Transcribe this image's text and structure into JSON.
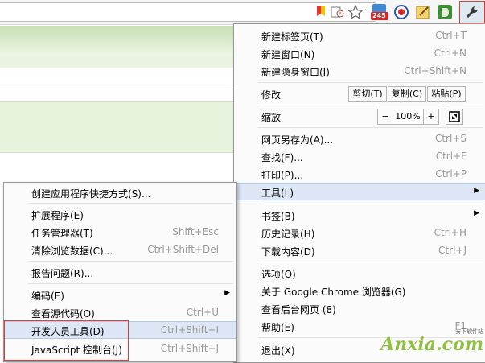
{
  "toolbar": {
    "icons": [
      "bookmark-flag-icon",
      "document-icon",
      "star-icon",
      "extension-245-icon",
      "extension-globe-icon",
      "extension-note-icon",
      "evernote-icon",
      "wrench-menu-icon"
    ],
    "badge_count": "245"
  },
  "main_menu": {
    "new_tab": {
      "label": "新建标签页(T)",
      "shortcut": "Ctrl+T"
    },
    "new_window": {
      "label": "新建窗口(N)",
      "shortcut": "Ctrl+N"
    },
    "new_incognito": {
      "label": "新建隐身窗口(I)",
      "shortcut": "Ctrl+Shift+N"
    },
    "edit": {
      "label": "修改",
      "cut": "剪切(T)",
      "copy": "复制(C)",
      "paste": "粘贴(P)"
    },
    "zoom": {
      "label": "缩放",
      "minus": "−",
      "value": "100%",
      "plus": "+"
    },
    "save_as": {
      "label": "网页另存为(A)...",
      "shortcut": "Ctrl+S"
    },
    "find": {
      "label": "查找(F)...",
      "shortcut": "Ctrl+F"
    },
    "print": {
      "label": "打印(P)...",
      "shortcut": "Ctrl+P"
    },
    "tools": {
      "label": "工具(L)"
    },
    "bookmarks": {
      "label": "书签(B)"
    },
    "history": {
      "label": "历史记录(H)",
      "shortcut": "Ctrl+H"
    },
    "downloads": {
      "label": "下载内容(D)",
      "shortcut": "Ctrl+J"
    },
    "options": {
      "label": "选项(O)"
    },
    "about": {
      "label": "关于 Google Chrome 浏览器(G)"
    },
    "background_pages": {
      "label": "查看后台网页 (8)"
    },
    "help": {
      "label": "帮助(E)",
      "shortcut": "F1"
    },
    "exit": {
      "label": "退出(X)"
    }
  },
  "tools_menu": {
    "create_shortcut": {
      "label": "创建应用程序快捷方式(S)..."
    },
    "extensions": {
      "label": "扩展程序(E)"
    },
    "task_manager": {
      "label": "任务管理器(T)",
      "shortcut": "Shift+Esc"
    },
    "clear_data": {
      "label": "清除浏览数据(C)...",
      "shortcut": "Ctrl+Shift+Del"
    },
    "report_issue": {
      "label": "报告问题(R)..."
    },
    "encoding": {
      "label": "编码(E)"
    },
    "view_source": {
      "label": "查看源代码(O)",
      "shortcut": "Ctrl+U"
    },
    "dev_tools": {
      "label": "开发人员工具(D)",
      "shortcut": "Ctrl+Shift+I"
    },
    "js_console": {
      "label": "JavaScript 控制台(J)",
      "shortcut": "Ctrl+Shift+J"
    }
  },
  "watermark": {
    "text": "Anxia.com",
    "sub": "安下软件站"
  },
  "colors": {
    "highlight": "#dce6f4",
    "annotation_red": "#e23b35",
    "watermark_green": "#8fc03f"
  }
}
